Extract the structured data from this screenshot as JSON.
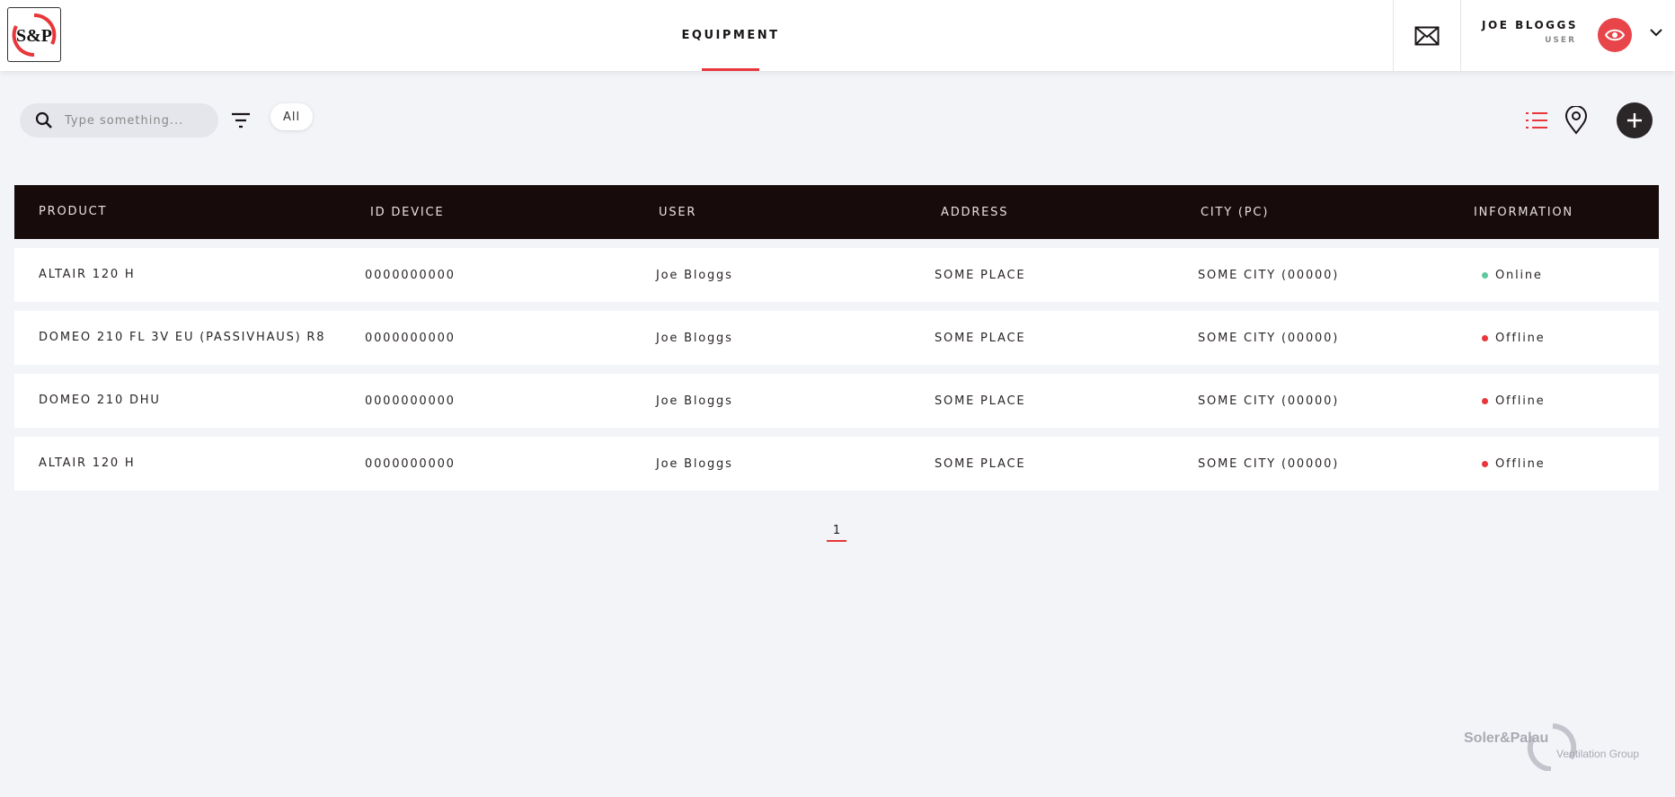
{
  "header": {
    "logo_text": "S&P",
    "nav_tab": "EQUIPMENT",
    "mail_icon": "envelope-icon",
    "user": {
      "name": "JOE BLOGGS",
      "role": "USER",
      "avatar_icon": "eye-icon"
    }
  },
  "toolbar": {
    "search_placeholder": "Type something...",
    "filter_chip": "All",
    "icons": [
      "search-icon",
      "filter-icon",
      "list-view-icon",
      "map-pin-icon",
      "plus-icon"
    ]
  },
  "table": {
    "columns": [
      "PRODUCT",
      "ID DEVICE",
      "USER",
      "ADDRESS",
      "CITY (PC)",
      "INFORMATION"
    ],
    "rows": [
      {
        "product": "ALTAIR 120 H",
        "id": "0000000000",
        "user": "Joe Bloggs",
        "address": "SOME PLACE",
        "city": "SOME CITY (00000)",
        "status": "Online"
      },
      {
        "product": "DOMEO 210 FL 3V EU (PASSIVHAUS) R8",
        "id": "0000000000",
        "user": "Joe Bloggs",
        "address": "SOME PLACE",
        "city": "SOME CITY (00000)",
        "status": "Offline"
      },
      {
        "product": "DOMEO 210 DHU",
        "id": "0000000000",
        "user": "Joe Bloggs",
        "address": "SOME PLACE",
        "city": "SOME CITY (00000)",
        "status": "Offline"
      },
      {
        "product": "ALTAIR 120 H",
        "id": "0000000000",
        "user": "Joe Bloggs",
        "address": "SOME PLACE",
        "city": "SOME CITY (00000)",
        "status": "Offline"
      }
    ]
  },
  "pagination": {
    "current_page": "1"
  },
  "footer": {
    "brand_name": "Soler&Palau",
    "brand_tagline": "Ventilation Group"
  },
  "colors": {
    "accent": "#e8363a",
    "online": "#5ec9a0",
    "offline": "#e8363a",
    "table_header": "#180b0c"
  }
}
